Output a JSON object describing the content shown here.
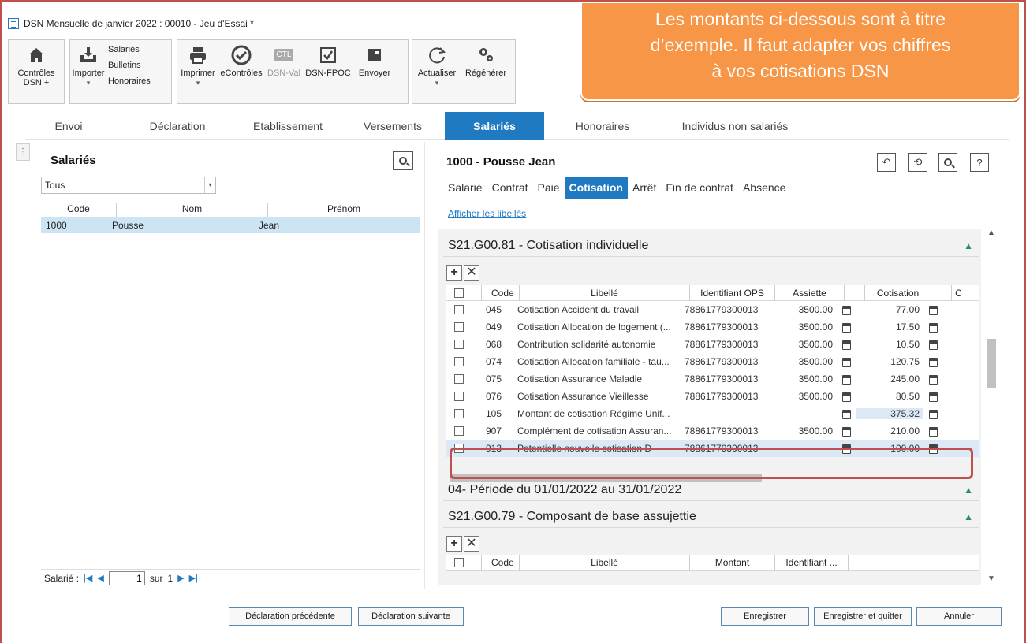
{
  "window": {
    "title": "DSN Mensuelle de janvier 2022 : 00010 - Jeu d'Essai *"
  },
  "toolbar": {
    "controles": "Contrôles\nDSN +",
    "controles_l1": "Contrôles",
    "controles_l2": "DSN +",
    "importer": "Importer",
    "salaries": "Salariés",
    "bulletins": "Bulletins",
    "honoraires": "Honoraires",
    "imprimer": "Imprimer",
    "econtroles": "eContrôles",
    "dsnval": "DSN-Val",
    "ctl": "CTL",
    "dsnfpoc": "DSN-FPOC",
    "envoyer": "Envoyer",
    "actualiser": "Actualiser",
    "regenerer": "Régénérer"
  },
  "callout": {
    "line1": "Les montants ci-dessous sont à titre",
    "line2": "d’exemple. Il faut adapter vos chiffres",
    "line3": "à vos cotisations DSN"
  },
  "tabs": [
    "Envoi",
    "Déclaration",
    "Etablissement",
    "Versements",
    "Salariés",
    "Honoraires",
    "Individus non salariés"
  ],
  "left": {
    "title": "Salariés",
    "filter": "Tous",
    "columns": [
      "Code",
      "Nom",
      "Prénom"
    ],
    "row": {
      "code": "1000",
      "nom": "Pousse",
      "prenom": "Jean"
    },
    "pager": {
      "label": "Salarié :",
      "page": "1",
      "sur": "sur",
      "total": "1"
    }
  },
  "right": {
    "title": "1000 - Pousse Jean",
    "subtabs": [
      "Salarié",
      "Contrat",
      "Paie",
      "Cotisation",
      "Arrêt",
      "Fin de contrat",
      "Absence"
    ],
    "link": "Afficher les libellés",
    "section1": "S21.G00.81 - Cotisation individuelle",
    "columns": [
      "Code",
      "Libellé",
      "Identifiant OPS",
      "Assiette",
      "Cotisation",
      "C"
    ],
    "rows": [
      {
        "code": "045",
        "libelle": "Cotisation Accident du travail",
        "ops": "78861779300013",
        "assiette": "3500.00",
        "cotisation": "77.00"
      },
      {
        "code": "049",
        "libelle": "Cotisation Allocation de logement (...",
        "ops": "78861779300013",
        "assiette": "3500.00",
        "cotisation": "17.50"
      },
      {
        "code": "068",
        "libelle": "Contribution solidarité autonomie",
        "ops": "78861779300013",
        "assiette": "3500.00",
        "cotisation": "10.50"
      },
      {
        "code": "074",
        "libelle": "Cotisation Allocation familiale - tau...",
        "ops": "78861779300013",
        "assiette": "3500.00",
        "cotisation": "120.75"
      },
      {
        "code": "075",
        "libelle": "Cotisation Assurance Maladie",
        "ops": "78861779300013",
        "assiette": "3500.00",
        "cotisation": "245.00"
      },
      {
        "code": "076",
        "libelle": "Cotisation Assurance Vieillesse",
        "ops": "78861779300013",
        "assiette": "3500.00",
        "cotisation": "80.50"
      },
      {
        "code": "105",
        "libelle": "Montant de cotisation Régime Unif...",
        "ops": "",
        "assiette": "",
        "cotisation": "375.32"
      },
      {
        "code": "907",
        "libelle": "Complément de cotisation Assuran...",
        "ops": "78861779300013",
        "assiette": "3500.00",
        "cotisation": "210.00"
      },
      {
        "code": "913",
        "libelle": "Potentielle nouvelle cotisation D",
        "ops": "78861779300013",
        "assiette": "",
        "cotisation": "-100.00"
      }
    ],
    "section2": "04- Période du 01/01/2022 au 31/01/2022",
    "section3": "S21.G00.79 - Composant de base assujettie",
    "columns2": [
      "Code",
      "Libellé",
      "Montant",
      "Identifiant ..."
    ]
  },
  "footer": {
    "prev": "Déclaration précédente",
    "next": "Déclaration suivante",
    "save": "Enregistrer",
    "save_quit": "Enregistrer et quitter",
    "cancel": "Annuler"
  },
  "colors": {
    "accent": "#1f7ac2",
    "callout": "#f79646",
    "highlight": "#c0504d"
  }
}
